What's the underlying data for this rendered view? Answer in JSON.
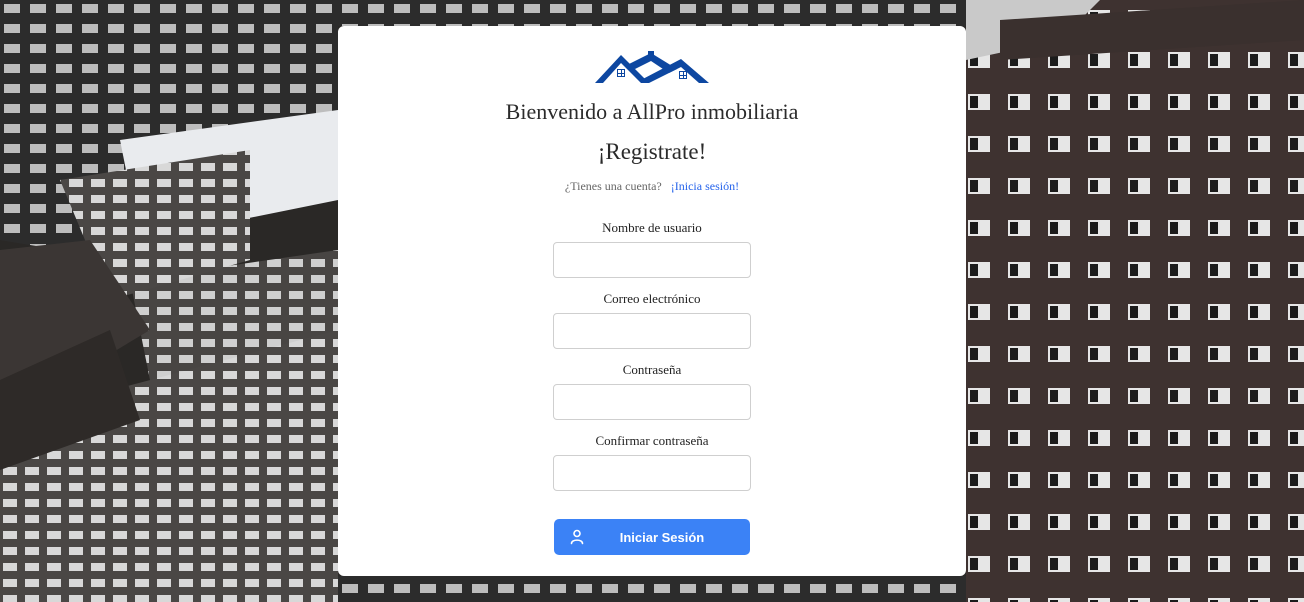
{
  "welcome_text": "Bienvenido a AllPro inmobiliaria",
  "subtitle": "¡Registrate!",
  "account_prompt": "¿Tienes una cuenta?",
  "login_link": "¡Inicia sesión!",
  "form": {
    "username_label": "Nombre de usuario",
    "username_value": "",
    "email_label": "Correo electrónico",
    "email_value": "",
    "password_label": "Contraseña",
    "password_value": "",
    "confirm_label": "Confirmar contraseña",
    "confirm_value": ""
  },
  "submit_label": "Iniciar Sesión",
  "icons": {
    "logo": "house-roofs-logo",
    "button": "user-icon"
  },
  "colors": {
    "brand": "#0d47a1",
    "button": "#3b82f6",
    "link": "#2563eb"
  }
}
